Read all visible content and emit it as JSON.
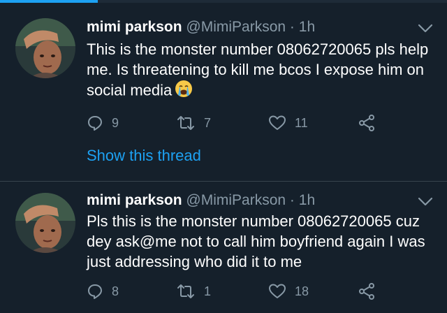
{
  "colors": {
    "background": "#15202b",
    "accent": "#1da1f2",
    "muted": "#8899a6",
    "divider": "#38444d"
  },
  "tweets": [
    {
      "name": "mimi parkson",
      "handle": "@MimiParkson",
      "dot": "·",
      "time": "1h",
      "text": "This is the monster number 08062720065 pls help me. Is threatening to kill me bcos I expose him on social media",
      "emoji": "crying-face-emoji",
      "replies": "9",
      "retweets": "7",
      "likes": "11",
      "show_thread": "Show this thread"
    },
    {
      "name": "mimi parkson",
      "handle": "@MimiParkson",
      "dot": "·",
      "time": "1h",
      "text": "Pls this is the monster number 08062720065 cuz dey ask@me not to call him boyfriend again I was just addressing who did it to me",
      "replies": "8",
      "retweets": "1",
      "likes": "18"
    }
  ]
}
